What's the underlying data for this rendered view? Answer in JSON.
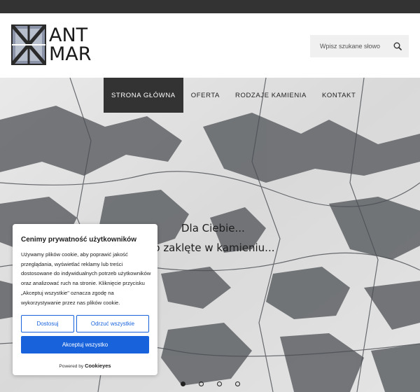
{
  "logo": {
    "line1": "ANT",
    "line2": "MAR"
  },
  "search": {
    "placeholder": "Wpisz szukane słowo"
  },
  "nav": {
    "items": [
      {
        "label": "STRONA GŁÓWNA",
        "active": true
      },
      {
        "label": "OFERTA"
      },
      {
        "label": "RODZAJE KAMIENIA"
      },
      {
        "label": "KONTAKT"
      }
    ]
  },
  "hero": {
    "line1": "Dla Ciebie...",
    "line2": "my piękno zaklęte w kamieniu..."
  },
  "slider": {
    "count": 4,
    "active": 1
  },
  "cookie": {
    "title": "Cenimy prywatność użytkowników",
    "body": "Używamy plików cookie, aby poprawić jakość przeglądania, wyświetlać reklamy lub treści dostosowane do indywidualnych potrzeb użytkowników oraz analizować ruch na stronie. Kliknięcie przycisku „Akceptuj wszystkie\" oznacza zgodę na wykorzystywanie przez nas plików cookie.",
    "customize_label": "Dostosuj",
    "reject_label": "Odrzuć wszystkie",
    "accept_label": "Akceptuj wszystko",
    "powered_prefix": "Powered by",
    "powered_brand": "Cookieyes"
  },
  "colors": {
    "topbar": "#333333",
    "nav_active": "#333333",
    "cookie_accent": "#1863dc"
  }
}
